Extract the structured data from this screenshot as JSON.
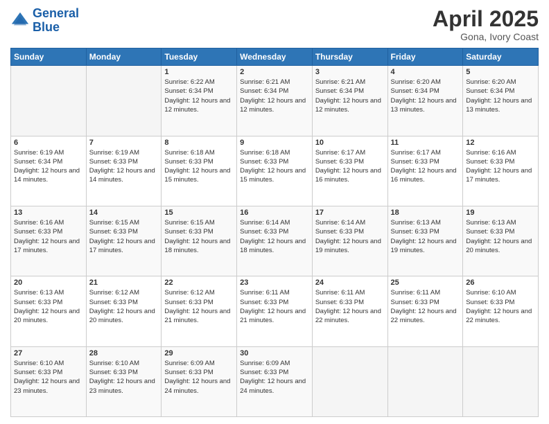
{
  "header": {
    "logo_line1": "General",
    "logo_line2": "Blue",
    "title": "April 2025",
    "subtitle": "Gona, Ivory Coast"
  },
  "calendar": {
    "days_of_week": [
      "Sunday",
      "Monday",
      "Tuesday",
      "Wednesday",
      "Thursday",
      "Friday",
      "Saturday"
    ],
    "weeks": [
      [
        {
          "day": "",
          "sunrise": "",
          "sunset": "",
          "daylight": ""
        },
        {
          "day": "",
          "sunrise": "",
          "sunset": "",
          "daylight": ""
        },
        {
          "day": "1",
          "sunrise": "Sunrise: 6:22 AM",
          "sunset": "Sunset: 6:34 PM",
          "daylight": "Daylight: 12 hours and 12 minutes."
        },
        {
          "day": "2",
          "sunrise": "Sunrise: 6:21 AM",
          "sunset": "Sunset: 6:34 PM",
          "daylight": "Daylight: 12 hours and 12 minutes."
        },
        {
          "day": "3",
          "sunrise": "Sunrise: 6:21 AM",
          "sunset": "Sunset: 6:34 PM",
          "daylight": "Daylight: 12 hours and 12 minutes."
        },
        {
          "day": "4",
          "sunrise": "Sunrise: 6:20 AM",
          "sunset": "Sunset: 6:34 PM",
          "daylight": "Daylight: 12 hours and 13 minutes."
        },
        {
          "day": "5",
          "sunrise": "Sunrise: 6:20 AM",
          "sunset": "Sunset: 6:34 PM",
          "daylight": "Daylight: 12 hours and 13 minutes."
        }
      ],
      [
        {
          "day": "6",
          "sunrise": "Sunrise: 6:19 AM",
          "sunset": "Sunset: 6:34 PM",
          "daylight": "Daylight: 12 hours and 14 minutes."
        },
        {
          "day": "7",
          "sunrise": "Sunrise: 6:19 AM",
          "sunset": "Sunset: 6:33 PM",
          "daylight": "Daylight: 12 hours and 14 minutes."
        },
        {
          "day": "8",
          "sunrise": "Sunrise: 6:18 AM",
          "sunset": "Sunset: 6:33 PM",
          "daylight": "Daylight: 12 hours and 15 minutes."
        },
        {
          "day": "9",
          "sunrise": "Sunrise: 6:18 AM",
          "sunset": "Sunset: 6:33 PM",
          "daylight": "Daylight: 12 hours and 15 minutes."
        },
        {
          "day": "10",
          "sunrise": "Sunrise: 6:17 AM",
          "sunset": "Sunset: 6:33 PM",
          "daylight": "Daylight: 12 hours and 16 minutes."
        },
        {
          "day": "11",
          "sunrise": "Sunrise: 6:17 AM",
          "sunset": "Sunset: 6:33 PM",
          "daylight": "Daylight: 12 hours and 16 minutes."
        },
        {
          "day": "12",
          "sunrise": "Sunrise: 6:16 AM",
          "sunset": "Sunset: 6:33 PM",
          "daylight": "Daylight: 12 hours and 17 minutes."
        }
      ],
      [
        {
          "day": "13",
          "sunrise": "Sunrise: 6:16 AM",
          "sunset": "Sunset: 6:33 PM",
          "daylight": "Daylight: 12 hours and 17 minutes."
        },
        {
          "day": "14",
          "sunrise": "Sunrise: 6:15 AM",
          "sunset": "Sunset: 6:33 PM",
          "daylight": "Daylight: 12 hours and 17 minutes."
        },
        {
          "day": "15",
          "sunrise": "Sunrise: 6:15 AM",
          "sunset": "Sunset: 6:33 PM",
          "daylight": "Daylight: 12 hours and 18 minutes."
        },
        {
          "day": "16",
          "sunrise": "Sunrise: 6:14 AM",
          "sunset": "Sunset: 6:33 PM",
          "daylight": "Daylight: 12 hours and 18 minutes."
        },
        {
          "day": "17",
          "sunrise": "Sunrise: 6:14 AM",
          "sunset": "Sunset: 6:33 PM",
          "daylight": "Daylight: 12 hours and 19 minutes."
        },
        {
          "day": "18",
          "sunrise": "Sunrise: 6:13 AM",
          "sunset": "Sunset: 6:33 PM",
          "daylight": "Daylight: 12 hours and 19 minutes."
        },
        {
          "day": "19",
          "sunrise": "Sunrise: 6:13 AM",
          "sunset": "Sunset: 6:33 PM",
          "daylight": "Daylight: 12 hours and 20 minutes."
        }
      ],
      [
        {
          "day": "20",
          "sunrise": "Sunrise: 6:13 AM",
          "sunset": "Sunset: 6:33 PM",
          "daylight": "Daylight: 12 hours and 20 minutes."
        },
        {
          "day": "21",
          "sunrise": "Sunrise: 6:12 AM",
          "sunset": "Sunset: 6:33 PM",
          "daylight": "Daylight: 12 hours and 20 minutes."
        },
        {
          "day": "22",
          "sunrise": "Sunrise: 6:12 AM",
          "sunset": "Sunset: 6:33 PM",
          "daylight": "Daylight: 12 hours and 21 minutes."
        },
        {
          "day": "23",
          "sunrise": "Sunrise: 6:11 AM",
          "sunset": "Sunset: 6:33 PM",
          "daylight": "Daylight: 12 hours and 21 minutes."
        },
        {
          "day": "24",
          "sunrise": "Sunrise: 6:11 AM",
          "sunset": "Sunset: 6:33 PM",
          "daylight": "Daylight: 12 hours and 22 minutes."
        },
        {
          "day": "25",
          "sunrise": "Sunrise: 6:11 AM",
          "sunset": "Sunset: 6:33 PM",
          "daylight": "Daylight: 12 hours and 22 minutes."
        },
        {
          "day": "26",
          "sunrise": "Sunrise: 6:10 AM",
          "sunset": "Sunset: 6:33 PM",
          "daylight": "Daylight: 12 hours and 22 minutes."
        }
      ],
      [
        {
          "day": "27",
          "sunrise": "Sunrise: 6:10 AM",
          "sunset": "Sunset: 6:33 PM",
          "daylight": "Daylight: 12 hours and 23 minutes."
        },
        {
          "day": "28",
          "sunrise": "Sunrise: 6:10 AM",
          "sunset": "Sunset: 6:33 PM",
          "daylight": "Daylight: 12 hours and 23 minutes."
        },
        {
          "day": "29",
          "sunrise": "Sunrise: 6:09 AM",
          "sunset": "Sunset: 6:33 PM",
          "daylight": "Daylight: 12 hours and 24 minutes."
        },
        {
          "day": "30",
          "sunrise": "Sunrise: 6:09 AM",
          "sunset": "Sunset: 6:33 PM",
          "daylight": "Daylight: 12 hours and 24 minutes."
        },
        {
          "day": "",
          "sunrise": "",
          "sunset": "",
          "daylight": ""
        },
        {
          "day": "",
          "sunrise": "",
          "sunset": "",
          "daylight": ""
        },
        {
          "day": "",
          "sunrise": "",
          "sunset": "",
          "daylight": ""
        }
      ]
    ]
  }
}
